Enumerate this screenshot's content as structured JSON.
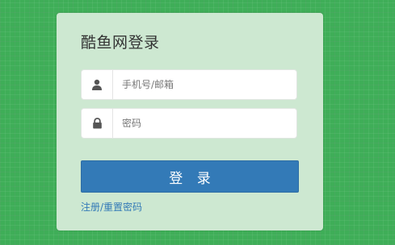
{
  "login": {
    "title": "酷鱼网登录",
    "username_placeholder": "手机号/邮箱",
    "password_placeholder": "密码",
    "submit_label": "登 录",
    "register_link": "注册/重置密码"
  },
  "colors": {
    "background": "#3fae58",
    "panel": "#cde8d1",
    "button": "#337ab7",
    "link": "#337ab7",
    "icon": "#555555"
  },
  "icons": {
    "username": "user-icon",
    "password": "lock-icon"
  }
}
